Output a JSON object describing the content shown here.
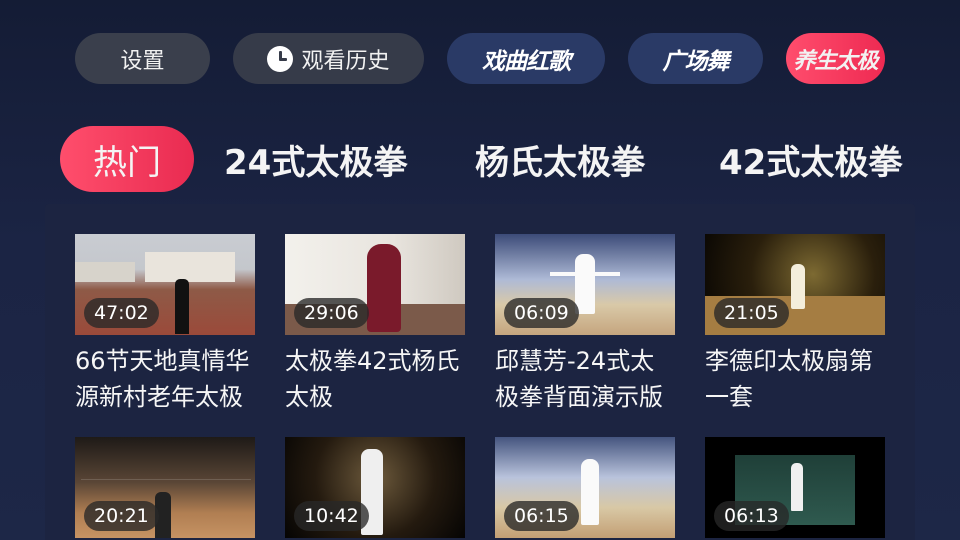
{
  "topbar": {
    "settings_label": "设置",
    "history_label": "观看历史",
    "history_icon": "clock-icon",
    "categories": [
      {
        "label": "戏曲红歌",
        "active": false
      },
      {
        "label": "广场舞",
        "active": false
      },
      {
        "label": "养生太极",
        "active": true
      }
    ]
  },
  "tabs": [
    {
      "label": "热门",
      "selected": true
    },
    {
      "label": "24式太极拳",
      "selected": false
    },
    {
      "label": "杨氏太极拳",
      "selected": false
    },
    {
      "label": "42式太极拳",
      "selected": false
    }
  ],
  "videos": [
    {
      "duration": "47:02",
      "title": "66节天地真情华源新村老年太极"
    },
    {
      "duration": "29:06",
      "title": "太极拳42式杨氏太极"
    },
    {
      "duration": "06:09",
      "title": "邱慧芳-24式太极拳背面演示版"
    },
    {
      "duration": "21:05",
      "title": "李德印太极扇第一套"
    },
    {
      "duration": "20:21",
      "title": ""
    },
    {
      "duration": "10:42",
      "title": ""
    },
    {
      "duration": "06:15",
      "title": ""
    },
    {
      "duration": "06:13",
      "title": ""
    }
  ],
  "colors": {
    "accent": "#ee2a52",
    "background": "#1b2444",
    "category_button": "#2a3a66"
  }
}
